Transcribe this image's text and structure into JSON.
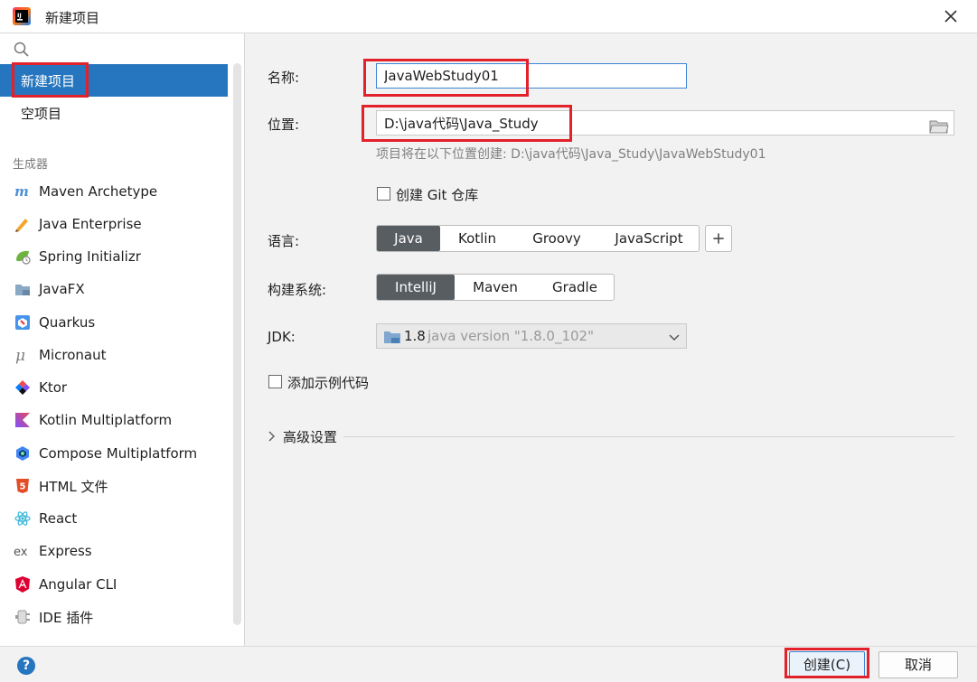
{
  "window": {
    "title": "新建项目"
  },
  "sidebar": {
    "selected": "新建项目",
    "top_items": [
      {
        "label": "新建项目"
      },
      {
        "label": "空项目"
      }
    ],
    "section_title": "生成器",
    "generators": [
      {
        "label": "Maven Archetype",
        "icon": "maven-icon"
      },
      {
        "label": "Java Enterprise",
        "icon": "java-enterprise-icon"
      },
      {
        "label": "Spring Initializr",
        "icon": "spring-icon"
      },
      {
        "label": "JavaFX",
        "icon": "javafx-icon"
      },
      {
        "label": "Quarkus",
        "icon": "quarkus-icon"
      },
      {
        "label": "Micronaut",
        "icon": "micronaut-icon"
      },
      {
        "label": "Ktor",
        "icon": "ktor-icon"
      },
      {
        "label": "Kotlin Multiplatform",
        "icon": "kotlin-icon"
      },
      {
        "label": "Compose Multiplatform",
        "icon": "compose-icon"
      },
      {
        "label": "HTML 文件",
        "icon": "html5-icon"
      },
      {
        "label": "React",
        "icon": "react-icon"
      },
      {
        "label": "Express",
        "icon": "express-icon"
      },
      {
        "label": "Angular CLI",
        "icon": "angular-icon"
      },
      {
        "label": "IDE 插件",
        "icon": "plugin-icon"
      }
    ]
  },
  "form": {
    "name_label": "名称:",
    "name_value": "JavaWebStudy01",
    "location_label": "位置:",
    "location_value": "D:\\java代码\\Java_Study",
    "location_hint": "项目将在以下位置创建: D:\\java代码\\Java_Study\\JavaWebStudy01",
    "git_label": "创建 Git 仓库",
    "git_checked": false,
    "language_label": "语言:",
    "languages": [
      "Java",
      "Kotlin",
      "Groovy",
      "JavaScript"
    ],
    "language_selected": "Java",
    "build_label": "构建系统:",
    "build_systems": [
      "IntelliJ",
      "Maven",
      "Gradle"
    ],
    "build_selected": "IntelliJ",
    "jdk_label": "JDK:",
    "jdk_version": "1.8",
    "jdk_desc": "java version \"1.8.0_102\"",
    "sample_label": "添加示例代码",
    "sample_checked": false,
    "advanced_label": "高级设置"
  },
  "footer": {
    "help": "?",
    "create_label": "创建(C)",
    "cancel_label": "取消"
  },
  "colors": {
    "selection_blue": "#2675bf",
    "segment_active": "#585d61",
    "annotation_red": "#e2212b"
  }
}
